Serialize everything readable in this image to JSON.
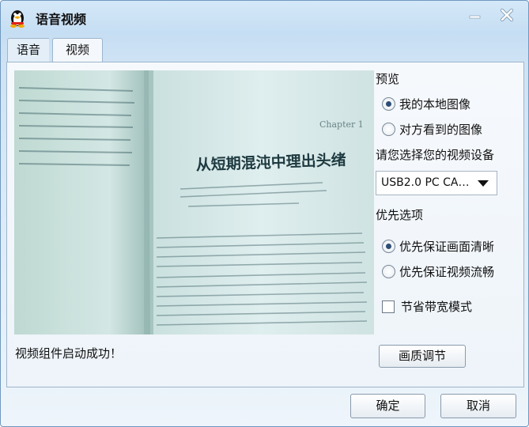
{
  "window": {
    "title": "语音视频",
    "app_icon": "penguin-icon"
  },
  "title_buttons": {
    "minimize_icon": "minimize-icon",
    "close_icon": "close-icon"
  },
  "tabs": [
    {
      "label": "语音",
      "active": false
    },
    {
      "label": "视频",
      "active": true
    }
  ],
  "preview": {
    "section_label": "预览",
    "options": [
      {
        "label": "我的本地图像",
        "selected": true
      },
      {
        "label": "对方看到的图像",
        "selected": false
      }
    ],
    "camera_image": {
      "heading": "从短期混沌中理出头绪",
      "chapter": "Chapter 1"
    }
  },
  "device": {
    "prompt": "请您选择您的视频设备",
    "selected_value": "USB2.0 PC CA…"
  },
  "priority": {
    "section_label": "优先选项",
    "options": [
      {
        "label": "优先保证画面清晰",
        "selected": true
      },
      {
        "label": "优先保证视频流畅",
        "selected": false
      }
    ]
  },
  "bandwidth_saver": {
    "label": "节省带宽模式",
    "checked": false
  },
  "status_message": "视频组件启动成功！",
  "buttons": {
    "quality": "画质调节",
    "ok": "确定",
    "cancel": "取消"
  },
  "colors": {
    "accent": "#2c4e76",
    "title_bar": "#c6def3",
    "border": "#6f98bf"
  }
}
